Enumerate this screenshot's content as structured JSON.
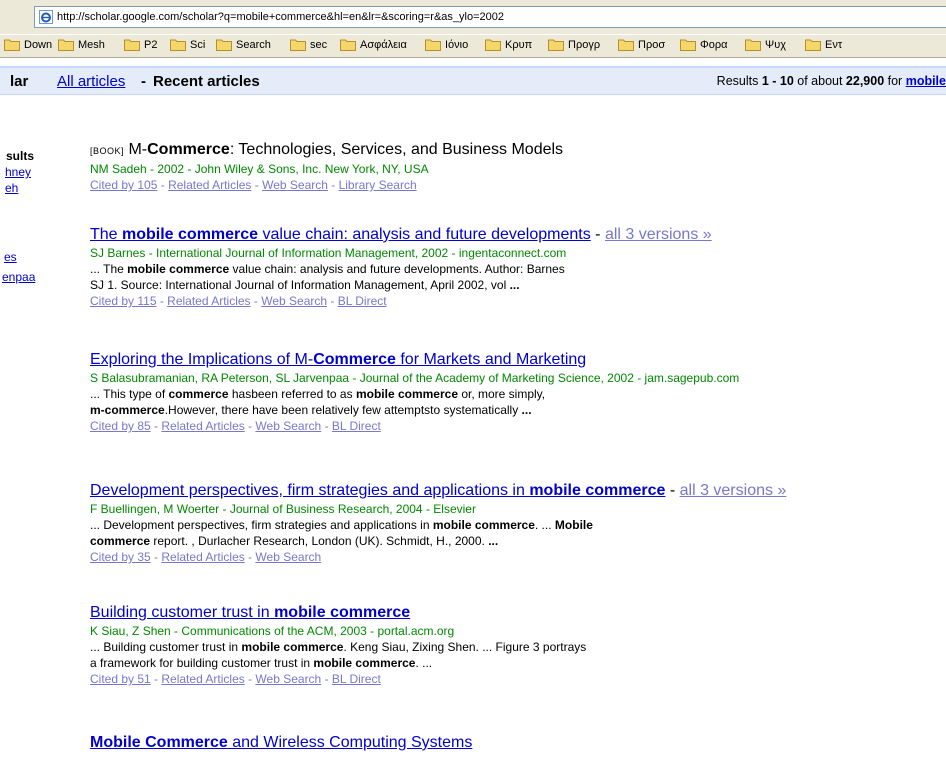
{
  "url": "http://scholar.google.com/scholar?q=mobile+commerce&hl=en&lr=&scoring=r&as_ylo=2002",
  "bookmarks": [
    "Down",
    "Mesh",
    "P2",
    "Sci",
    "Search",
    "sec",
    "Ασφάλεια",
    "Ιόνιο",
    "Κρυπ",
    "Προγρ",
    "Προσ",
    "Φορα",
    "Ψυχ",
    "Εντ"
  ],
  "header": {
    "brand": "lar",
    "all_articles": "All articles",
    "dash": "-",
    "recent_articles": "Recent articles",
    "results_prefix": "Results ",
    "range": "1 - 10",
    "of_about": " of about ",
    "count": "22,900",
    "for_text": " for ",
    "query": "mobile"
  },
  "sidebar": {
    "heading": "sults",
    "link1a": "hney",
    "link1b": "eh",
    "link2a": "es",
    "link2b": "enpaa"
  },
  "results": [
    {
      "book_tag": "[BOOK]",
      "title_a": "M-",
      "title_b": "Commerce",
      "title_c": ": Technologies, Services, and Business Models",
      "meta": "NM Sadeh - 2002 - John Wiley & Sons, Inc. New York, NY, USA",
      "cited": "Cited by 105",
      "related": "Related Articles",
      "web": "Web Search",
      "extra": "Library Search"
    },
    {
      "t1": "The ",
      "t2": "mobile commerce",
      "t3": " value chain: analysis and future developments",
      "dash": " - ",
      "versions": "all 3 versions »",
      "meta": "SJ Barnes - International Journal of Information Management, 2002 - ingentaconnect.com",
      "s1": "... The ",
      "s2": "mobile commerce",
      "s3": " value chain: analysis and future developments. Author: Barnes",
      "s4": "SJ 1. Source: International Journal of Information Management, April 2002, vol ",
      "s5": "...",
      "cited": "Cited by 115",
      "related": "Related Articles",
      "web": "Web Search",
      "extra": "BL Direct"
    },
    {
      "t1": "Exploring the Implications of M-",
      "t2": "Commerce",
      "t3": " for Markets and Marketing",
      "meta": "S Balasubramanian, RA Peterson, SL Jarvenpaa - Journal of the Academy of Marketing Science, 2002 - jam.sagepub.com",
      "s1": "... This type of ",
      "s2": "commerce",
      "s3": " hasbeen referred to as ",
      "s4": "mobile commerce",
      "s5": " or, more simply,",
      "s6": "m-commerce",
      "s7": ".However, there have been relatively few attemptsto systematically ",
      "s8": "...",
      "cited": "Cited by 85",
      "related": "Related Articles",
      "web": "Web Search",
      "extra": "BL Direct"
    },
    {
      "t1": "Development perspectives, firm strategies and applications in ",
      "t2": "mobile commerce",
      "dash": " - ",
      "versions": "all 3 versions »",
      "meta": "F Buellingen, M Woerter - Journal of Business Research, 2004 - Elsevier",
      "s1": "... Development perspectives, firm strategies and applications in ",
      "s2": "mobile commerce",
      "s3": ". ... ",
      "s4": "Mobile",
      "s5": "commerce",
      "s6": " report. , Durlacher Research, London (UK). Schmidt, H., 2000. ",
      "s7": "...",
      "cited": "Cited by 35",
      "related": "Related Articles",
      "web": "Web Search"
    },
    {
      "t1": "Building customer trust in ",
      "t2": "mobile commerce",
      "meta": "K Siau, Z Shen - Communications of the ACM, 2003 - portal.acm.org",
      "s1": "... Building customer trust in ",
      "s2": "mobile commerce",
      "s3": ". Keng Siau, Zixing Shen. ... Figure 3 portrays",
      "s4": "a framework for building customer trust in ",
      "s5": "mobile commerce",
      "s6": ". ...",
      "cited": "Cited by 51",
      "related": "Related Articles",
      "web": "Web Search",
      "extra": "BL Direct"
    },
    {
      "t1": "Mobile Commerce",
      "t2": " and Wireless Computing Systems"
    }
  ],
  "link_sep": " - "
}
